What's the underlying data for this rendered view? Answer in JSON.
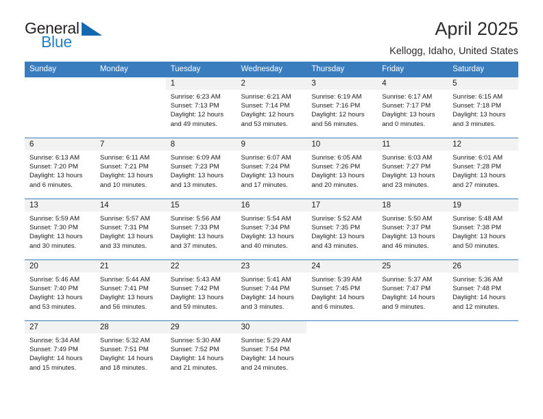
{
  "brand": {
    "name_part1": "General",
    "name_part2": "Blue",
    "triangle_color": "#1469b0",
    "blue_color": "#2080c8"
  },
  "header": {
    "title": "April 2025",
    "location": "Kellogg, Idaho, United States"
  },
  "theme": {
    "header_bg": "#3a7dbf",
    "header_text": "#ffffff",
    "daynum_bg": "#f2f2f2",
    "cell_bg": "#ffffff",
    "border": "#3a7dbf"
  },
  "weekday_headers": [
    "Sunday",
    "Monday",
    "Tuesday",
    "Wednesday",
    "Thursday",
    "Friday",
    "Saturday"
  ],
  "labels": {
    "sunrise_prefix": "Sunrise:",
    "sunset_prefix": "Sunset:",
    "daylight_prefix": "Daylight:"
  },
  "weeks": [
    [
      {
        "day": "",
        "empty": true
      },
      {
        "day": "",
        "empty": true
      },
      {
        "day": "1",
        "sunrise": "Sunrise: 6:23 AM",
        "sunset": "Sunset: 7:13 PM",
        "daylight1": "Daylight: 12 hours",
        "daylight2": "and 49 minutes."
      },
      {
        "day": "2",
        "sunrise": "Sunrise: 6:21 AM",
        "sunset": "Sunset: 7:14 PM",
        "daylight1": "Daylight: 12 hours",
        "daylight2": "and 53 minutes."
      },
      {
        "day": "3",
        "sunrise": "Sunrise: 6:19 AM",
        "sunset": "Sunset: 7:16 PM",
        "daylight1": "Daylight: 12 hours",
        "daylight2": "and 56 minutes."
      },
      {
        "day": "4",
        "sunrise": "Sunrise: 6:17 AM",
        "sunset": "Sunset: 7:17 PM",
        "daylight1": "Daylight: 13 hours",
        "daylight2": "and 0 minutes."
      },
      {
        "day": "5",
        "sunrise": "Sunrise: 6:15 AM",
        "sunset": "Sunset: 7:18 PM",
        "daylight1": "Daylight: 13 hours",
        "daylight2": "and 3 minutes."
      }
    ],
    [
      {
        "day": "6",
        "sunrise": "Sunrise: 6:13 AM",
        "sunset": "Sunset: 7:20 PM",
        "daylight1": "Daylight: 13 hours",
        "daylight2": "and 6 minutes."
      },
      {
        "day": "7",
        "sunrise": "Sunrise: 6:11 AM",
        "sunset": "Sunset: 7:21 PM",
        "daylight1": "Daylight: 13 hours",
        "daylight2": "and 10 minutes."
      },
      {
        "day": "8",
        "sunrise": "Sunrise: 6:09 AM",
        "sunset": "Sunset: 7:23 PM",
        "daylight1": "Daylight: 13 hours",
        "daylight2": "and 13 minutes."
      },
      {
        "day": "9",
        "sunrise": "Sunrise: 6:07 AM",
        "sunset": "Sunset: 7:24 PM",
        "daylight1": "Daylight: 13 hours",
        "daylight2": "and 17 minutes."
      },
      {
        "day": "10",
        "sunrise": "Sunrise: 6:05 AM",
        "sunset": "Sunset: 7:26 PM",
        "daylight1": "Daylight: 13 hours",
        "daylight2": "and 20 minutes."
      },
      {
        "day": "11",
        "sunrise": "Sunrise: 6:03 AM",
        "sunset": "Sunset: 7:27 PM",
        "daylight1": "Daylight: 13 hours",
        "daylight2": "and 23 minutes."
      },
      {
        "day": "12",
        "sunrise": "Sunrise: 6:01 AM",
        "sunset": "Sunset: 7:28 PM",
        "daylight1": "Daylight: 13 hours",
        "daylight2": "and 27 minutes."
      }
    ],
    [
      {
        "day": "13",
        "sunrise": "Sunrise: 5:59 AM",
        "sunset": "Sunset: 7:30 PM",
        "daylight1": "Daylight: 13 hours",
        "daylight2": "and 30 minutes."
      },
      {
        "day": "14",
        "sunrise": "Sunrise: 5:57 AM",
        "sunset": "Sunset: 7:31 PM",
        "daylight1": "Daylight: 13 hours",
        "daylight2": "and 33 minutes."
      },
      {
        "day": "15",
        "sunrise": "Sunrise: 5:56 AM",
        "sunset": "Sunset: 7:33 PM",
        "daylight1": "Daylight: 13 hours",
        "daylight2": "and 37 minutes."
      },
      {
        "day": "16",
        "sunrise": "Sunrise: 5:54 AM",
        "sunset": "Sunset: 7:34 PM",
        "daylight1": "Daylight: 13 hours",
        "daylight2": "and 40 minutes."
      },
      {
        "day": "17",
        "sunrise": "Sunrise: 5:52 AM",
        "sunset": "Sunset: 7:35 PM",
        "daylight1": "Daylight: 13 hours",
        "daylight2": "and 43 minutes."
      },
      {
        "day": "18",
        "sunrise": "Sunrise: 5:50 AM",
        "sunset": "Sunset: 7:37 PM",
        "daylight1": "Daylight: 13 hours",
        "daylight2": "and 46 minutes."
      },
      {
        "day": "19",
        "sunrise": "Sunrise: 5:48 AM",
        "sunset": "Sunset: 7:38 PM",
        "daylight1": "Daylight: 13 hours",
        "daylight2": "and 50 minutes."
      }
    ],
    [
      {
        "day": "20",
        "sunrise": "Sunrise: 5:46 AM",
        "sunset": "Sunset: 7:40 PM",
        "daylight1": "Daylight: 13 hours",
        "daylight2": "and 53 minutes."
      },
      {
        "day": "21",
        "sunrise": "Sunrise: 5:44 AM",
        "sunset": "Sunset: 7:41 PM",
        "daylight1": "Daylight: 13 hours",
        "daylight2": "and 56 minutes."
      },
      {
        "day": "22",
        "sunrise": "Sunrise: 5:43 AM",
        "sunset": "Sunset: 7:42 PM",
        "daylight1": "Daylight: 13 hours",
        "daylight2": "and 59 minutes."
      },
      {
        "day": "23",
        "sunrise": "Sunrise: 5:41 AM",
        "sunset": "Sunset: 7:44 PM",
        "daylight1": "Daylight: 14 hours",
        "daylight2": "and 3 minutes."
      },
      {
        "day": "24",
        "sunrise": "Sunrise: 5:39 AM",
        "sunset": "Sunset: 7:45 PM",
        "daylight1": "Daylight: 14 hours",
        "daylight2": "and 6 minutes."
      },
      {
        "day": "25",
        "sunrise": "Sunrise: 5:37 AM",
        "sunset": "Sunset: 7:47 PM",
        "daylight1": "Daylight: 14 hours",
        "daylight2": "and 9 minutes."
      },
      {
        "day": "26",
        "sunrise": "Sunrise: 5:36 AM",
        "sunset": "Sunset: 7:48 PM",
        "daylight1": "Daylight: 14 hours",
        "daylight2": "and 12 minutes."
      }
    ],
    [
      {
        "day": "27",
        "sunrise": "Sunrise: 5:34 AM",
        "sunset": "Sunset: 7:49 PM",
        "daylight1": "Daylight: 14 hours",
        "daylight2": "and 15 minutes."
      },
      {
        "day": "28",
        "sunrise": "Sunrise: 5:32 AM",
        "sunset": "Sunset: 7:51 PM",
        "daylight1": "Daylight: 14 hours",
        "daylight2": "and 18 minutes."
      },
      {
        "day": "29",
        "sunrise": "Sunrise: 5:30 AM",
        "sunset": "Sunset: 7:52 PM",
        "daylight1": "Daylight: 14 hours",
        "daylight2": "and 21 minutes."
      },
      {
        "day": "30",
        "sunrise": "Sunrise: 5:29 AM",
        "sunset": "Sunset: 7:54 PM",
        "daylight1": "Daylight: 14 hours",
        "daylight2": "and 24 minutes."
      },
      {
        "day": "",
        "empty": true
      },
      {
        "day": "",
        "empty": true
      },
      {
        "day": "",
        "empty": true
      }
    ]
  ]
}
